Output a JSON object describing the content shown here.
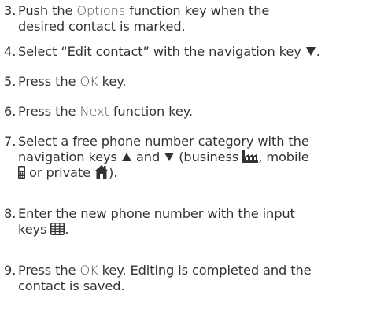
{
  "steps": [
    {
      "number": "3.",
      "line1_pre": "Push the ",
      "line1_key": "Options",
      "line1_post": " function key when the",
      "line2": "desired contact is marked."
    },
    {
      "number": "4.",
      "text_pre": "Select “Edit contact” with the navigation key ",
      "icon": "down-triangle-icon",
      "text_post": "."
    },
    {
      "number": "5.",
      "text_pre": "Press the ",
      "key": "OK",
      "text_post": " key."
    },
    {
      "number": "6.",
      "text_pre": "Press the ",
      "key": "Next",
      "text_post": " function key."
    },
    {
      "number": "7.",
      "line1": "Select a free phone number category with the",
      "line2_pre": "navigation keys ",
      "line2_and": " and ",
      "line2_business": " (business ",
      "line2_mobile": ", mobile",
      "line3_or": " or private ",
      "line3_end": ").",
      "icons": [
        "up-triangle-icon",
        "down-triangle-icon",
        "business-icon",
        "mobile-icon",
        "private-home-icon"
      ]
    },
    {
      "number": "8.",
      "line1": "Enter the new phone number with the input",
      "line2_pre": "keys ",
      "icon": "keypad-icon",
      "line2_post": "."
    },
    {
      "number": "9.",
      "line1_pre": "Press the ",
      "line1_key": "OK",
      "line1_post": " key. Editing is completed and the",
      "line2": "contact is saved."
    }
  ],
  "colors": {
    "text": "#333333",
    "key_text": "#555555",
    "background": "#ffffff"
  }
}
